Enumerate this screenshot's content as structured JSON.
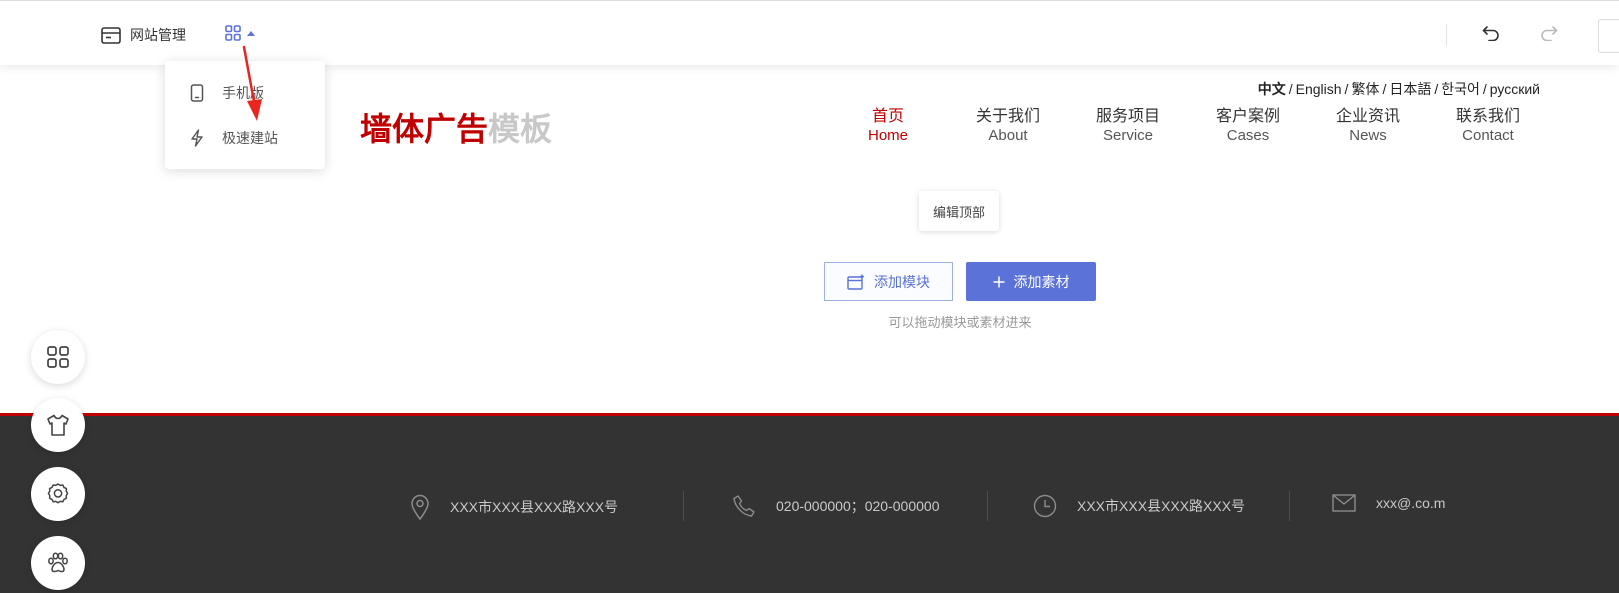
{
  "toolbar": {
    "site_management_label": "网站管理",
    "apps_icon": "grid-apps-icon",
    "undo_icon": "undo-icon",
    "redo_icon": "redo-icon"
  },
  "dropdown": {
    "items": [
      {
        "label": "手机版",
        "icon": "mobile-phone-icon"
      },
      {
        "label": "极速建站",
        "icon": "lightning-icon"
      }
    ]
  },
  "site": {
    "logo_part1": "墙体广告",
    "logo_part2": "模板",
    "languages": [
      "中文",
      "English",
      "繁体",
      "日本語",
      "한국어",
      "русский"
    ],
    "language_separator": "/",
    "nav": [
      {
        "cn": "首页",
        "en": "Home",
        "active": true
      },
      {
        "cn": "关于我们",
        "en": "About"
      },
      {
        "cn": "服务项目",
        "en": "Service"
      },
      {
        "cn": "客户案例",
        "en": "Cases"
      },
      {
        "cn": "企业资讯",
        "en": "News"
      },
      {
        "cn": "联系我们",
        "en": "Contact"
      }
    ]
  },
  "editor": {
    "edit_top_label": "编辑顶部",
    "add_module_label": "添加模块",
    "add_material_label": "添加素材",
    "drag_hint": "可以拖动模块或素材进来"
  },
  "footer": {
    "address": "XXX市XXX县XXX路XXX号",
    "phone": "020-000000；020-000000",
    "hours": "XXX市XXX县XXX路XXX号",
    "email": "xxx@.co.m"
  },
  "colors": {
    "brand_red": "#c00000",
    "accent_blue": "#5b73d9",
    "footer_bg": "#333333"
  }
}
